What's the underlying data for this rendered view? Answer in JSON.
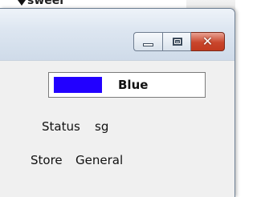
{
  "background_window": {
    "partial_text": "sweel"
  },
  "window": {
    "buttons": {
      "minimize": "minimize-icon",
      "maximize": "maximize-icon",
      "close_glyph": "✕"
    }
  },
  "color_display": {
    "swatch_color": "#2200ff",
    "color_name": "Blue"
  },
  "status": {
    "label": "Status",
    "value": "sg"
  },
  "store": {
    "label": "Store",
    "value": "General"
  }
}
